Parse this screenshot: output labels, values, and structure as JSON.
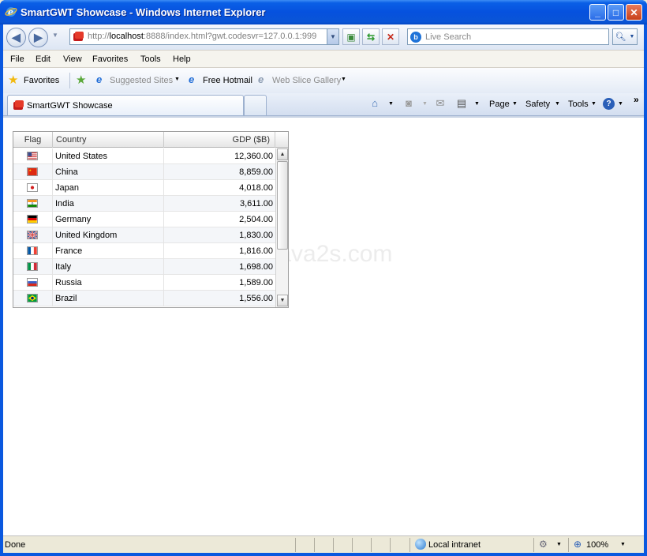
{
  "window": {
    "title": "SmartGWT Showcase - Windows Internet Explorer",
    "minimize": "_",
    "maximize": "□",
    "close": "✕"
  },
  "address": {
    "url_prefix": "http://",
    "url_host": "localhost",
    "url_rest": ":8888/index.html?gwt.codesvr=127.0.0.1:999"
  },
  "search": {
    "placeholder": "Live Search",
    "engine_letter": "b"
  },
  "menu": [
    "File",
    "Edit",
    "View",
    "Favorites",
    "Tools",
    "Help"
  ],
  "favorites_bar": {
    "favorites_label": "Favorites",
    "suggested_sites": "Suggested Sites",
    "free_hotmail": "Free Hotmail",
    "web_slice_gallery": "Web Slice Gallery"
  },
  "tab": {
    "label": "SmartGWT Showcase"
  },
  "command_bar": {
    "page": "Page",
    "safety": "Safety",
    "tools": "Tools",
    "overflow": "»"
  },
  "grid": {
    "columns": {
      "flag": "Flag",
      "country": "Country",
      "gdp": "GDP ($B)"
    },
    "rows": [
      {
        "country": "United States",
        "gdp": "12,360.00",
        "flag": "us"
      },
      {
        "country": "China",
        "gdp": "8,859.00",
        "flag": "cn"
      },
      {
        "country": "Japan",
        "gdp": "4,018.00",
        "flag": "jp"
      },
      {
        "country": "India",
        "gdp": "3,611.00",
        "flag": "in"
      },
      {
        "country": "Germany",
        "gdp": "2,504.00",
        "flag": "de"
      },
      {
        "country": "United Kingdom",
        "gdp": "1,830.00",
        "flag": "gb"
      },
      {
        "country": "France",
        "gdp": "1,816.00",
        "flag": "fr"
      },
      {
        "country": "Italy",
        "gdp": "1,698.00",
        "flag": "it"
      },
      {
        "country": "Russia",
        "gdp": "1,589.00",
        "flag": "ru"
      },
      {
        "country": "Brazil",
        "gdp": "1,556.00",
        "flag": "br"
      }
    ]
  },
  "watermark": "www.java2s.com",
  "status": {
    "text": "Done",
    "zone": "Local intranet",
    "zoom": "100%"
  }
}
